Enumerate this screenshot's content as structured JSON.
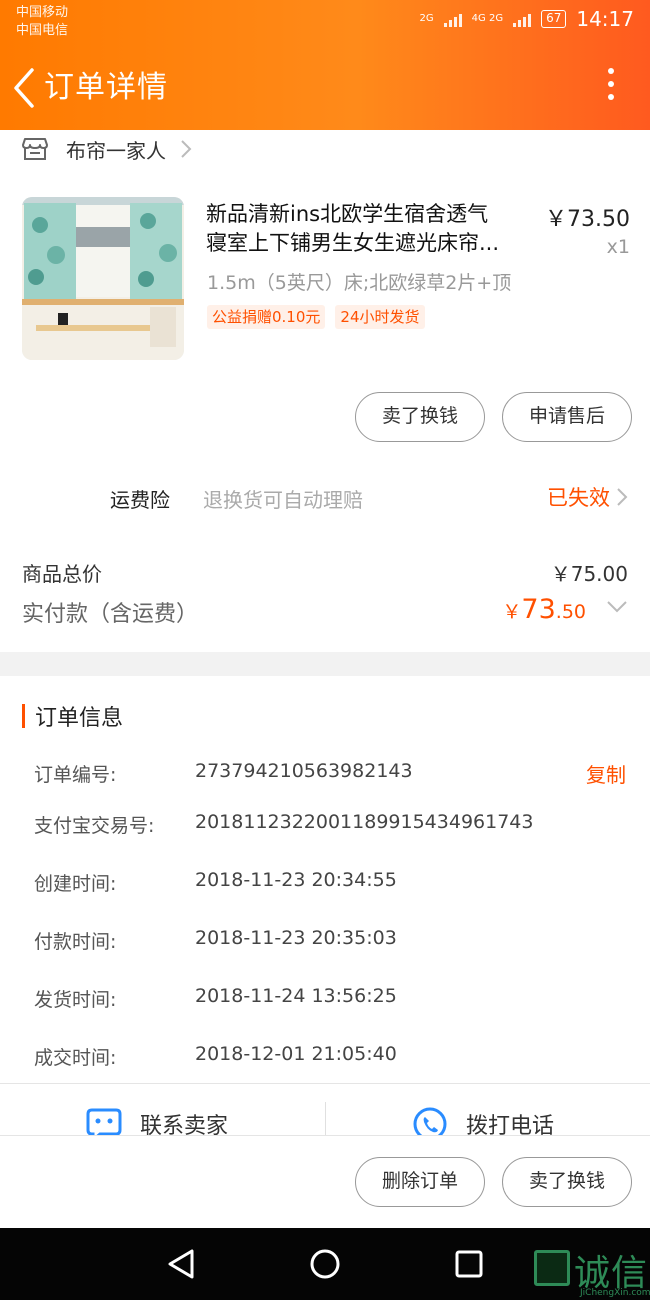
{
  "status_bar": {
    "carrier1": "中国移动",
    "carrier2": "中国电信",
    "net1": "2G",
    "net2": "4G 2G",
    "battery": "67",
    "time": "14:17"
  },
  "header": {
    "title": "订单详情",
    "back_icon": "chevron-left-icon",
    "more_icon": "more-vertical-icon"
  },
  "shop": {
    "icon": "store-icon",
    "name": "布帘一家人"
  },
  "product": {
    "title_line1": "新品清新ins北欧学生宿舍透气",
    "title_line2": "寝室上下铺男生女生遮光床帘...",
    "price": "￥73.50",
    "quantity": "x1",
    "sku": "1.5m（5英尺）床;北欧绿草2片+顶",
    "tags": [
      "公益捐赠0.10元",
      "24小时发货"
    ]
  },
  "item_actions": {
    "sell_label": "卖了换钱",
    "after_sale_label": "申请售后"
  },
  "insurance": {
    "label": "运费险",
    "desc": "退换货可自动理赔",
    "status": "已失效"
  },
  "totals": {
    "goods_total_label": "商品总价",
    "goods_total_value": "￥75.00",
    "paid_label": "实付款（含运费）",
    "paid_currency": "￥",
    "paid_int": "73",
    "paid_dec": ".50"
  },
  "order_info": {
    "title": "订单信息",
    "copy_label": "复制",
    "rows": [
      {
        "label": "订单编号:",
        "value": "273794210563982143"
      },
      {
        "label": "支付宝交易号:",
        "value": "2018112322001189915434961743"
      },
      {
        "label": "创建时间:",
        "value": "2018-11-23 20:34:55"
      },
      {
        "label": "付款时间:",
        "value": "2018-11-23 20:35:03"
      },
      {
        "label": "发货时间:",
        "value": "2018-11-24 13:56:25"
      },
      {
        "label": "成交时间:",
        "value": "2018-12-01 21:05:40"
      }
    ]
  },
  "contact": {
    "chat_label": "联系卖家",
    "call_label": "拨打电话"
  },
  "bottom_actions": {
    "delete_label": "删除订单",
    "sell_label": "卖了换钱"
  },
  "watermark": {
    "text": "诚信",
    "sub": "JiChengXin.com"
  },
  "colors": {
    "accent": "#ff5000",
    "header_start": "#ff7a00",
    "header_end": "#ff5a1f"
  }
}
